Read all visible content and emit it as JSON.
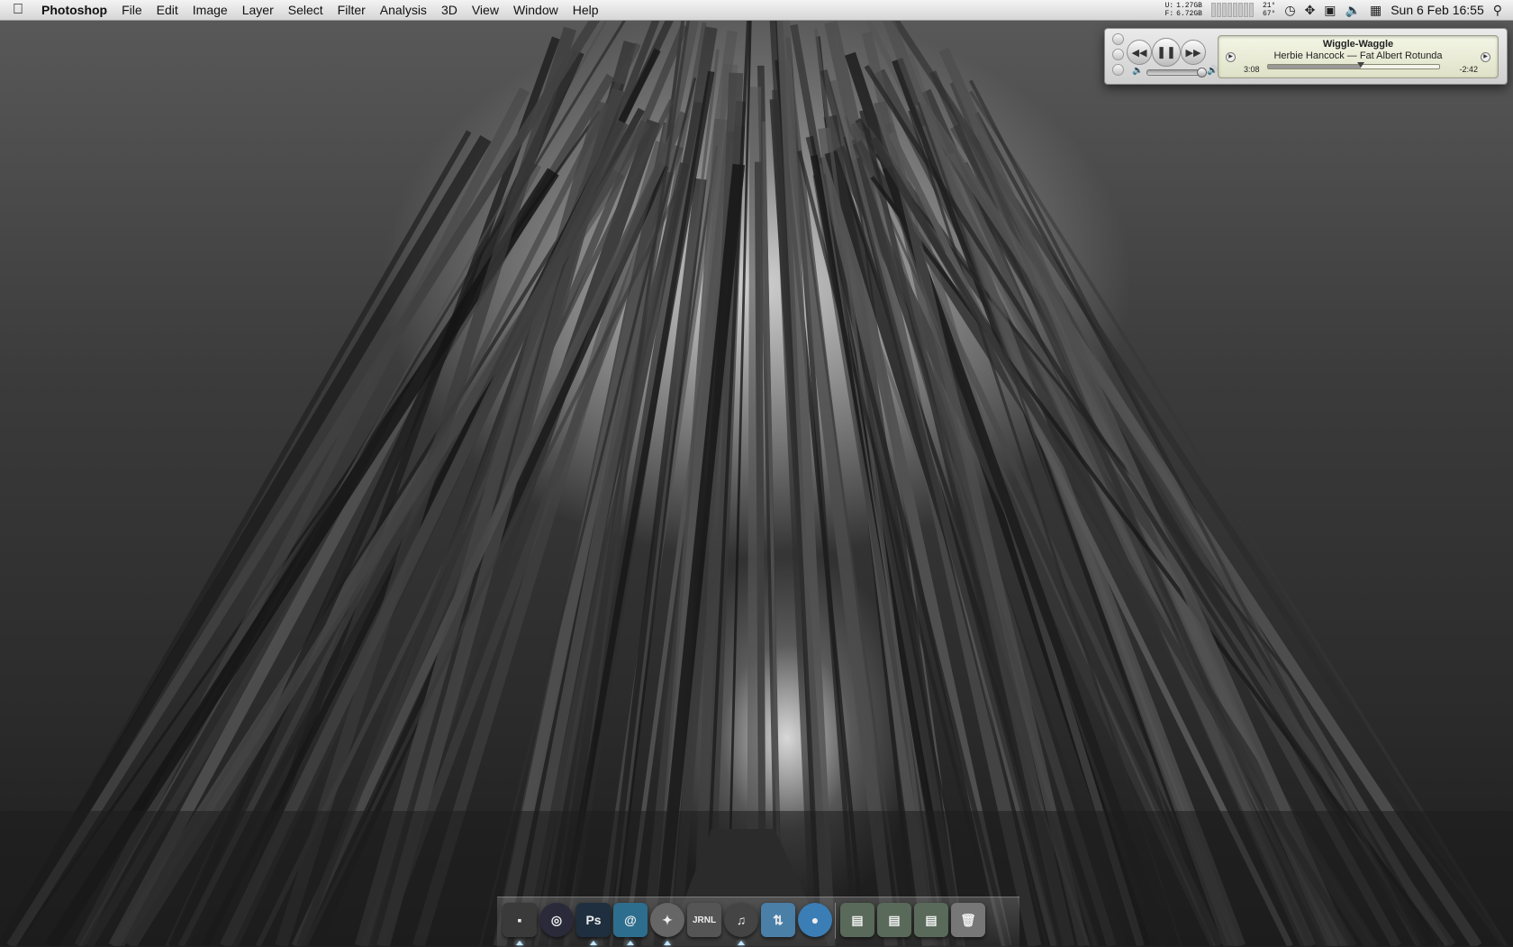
{
  "menubar": {
    "apple_icon": "apple-icon",
    "app_name": "Photoshop",
    "menus": [
      "File",
      "Edit",
      "Image",
      "Layer",
      "Select",
      "Filter",
      "Analysis",
      "3D",
      "View",
      "Window",
      "Help"
    ],
    "status": {
      "mem_labels": [
        "U:",
        "F:"
      ],
      "mem_values": [
        "1.27GB",
        "6.72GB"
      ],
      "temp_values": [
        "21°",
        "67°"
      ],
      "clock": "Sun 6 Feb  16:55"
    }
  },
  "miniplayer": {
    "track_title": "Wiggle-Waggle",
    "artist_album": "Herbie Hancock — Fat Albert Rotunda",
    "elapsed": "3:08",
    "remaining": "-2:42",
    "progress_fraction": 0.54,
    "volume_fraction": 0.92
  },
  "dock": {
    "items": [
      {
        "name": "finder-dock-icon",
        "glyph": "▪",
        "bg": "#3a3a3a",
        "running": true
      },
      {
        "name": "aperture-dock-icon",
        "glyph": "◎",
        "bg": "#2a2a3a",
        "running": false
      },
      {
        "name": "photoshop-dock-icon",
        "glyph": "Ps",
        "bg": "#1f2f3f",
        "running": true
      },
      {
        "name": "mail-dock-icon",
        "glyph": "@",
        "bg": "#2d6e8e",
        "running": true
      },
      {
        "name": "safari-dock-icon",
        "glyph": "✦",
        "bg": "#666",
        "running": true
      },
      {
        "name": "journler-dock-icon",
        "glyph": "JRNL",
        "bg": "#555",
        "running": false
      },
      {
        "name": "itunes-dock-icon",
        "glyph": "♫",
        "bg": "#444",
        "running": true
      },
      {
        "name": "transmit-dock-icon",
        "glyph": "⇅",
        "bg": "#4a7fa8",
        "running": false
      },
      {
        "name": "quicktime-dock-icon",
        "glyph": "●",
        "bg": "#3b7db5",
        "running": false
      },
      {
        "name": "stack-1-dock-icon",
        "glyph": "▤",
        "bg": "#5a6a5a",
        "running": false
      },
      {
        "name": "stack-2-dock-icon",
        "glyph": "▤",
        "bg": "#5a6a5a",
        "running": false
      },
      {
        "name": "stack-3-dock-icon",
        "glyph": "▤",
        "bg": "#5a6a5a",
        "running": false
      },
      {
        "name": "trash-dock-icon",
        "glyph": "🗑",
        "bg": "#777",
        "running": false
      }
    ]
  }
}
